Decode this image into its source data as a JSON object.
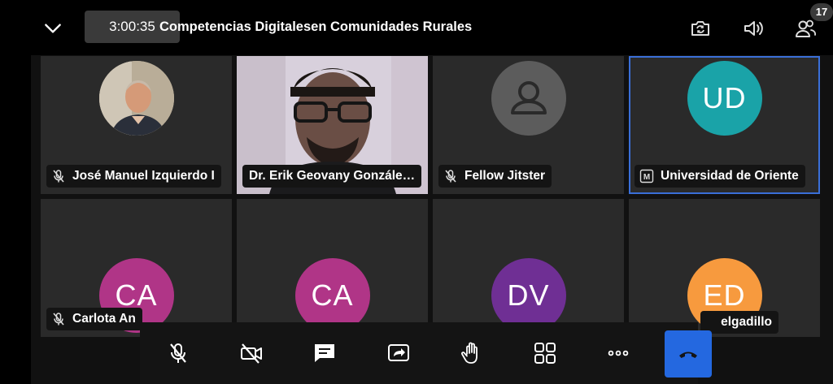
{
  "header": {
    "timer": "3:00:35",
    "title": "Competencias Digitalesen Comunidades Rurales",
    "participant_count": "17"
  },
  "participants": [
    {
      "name": "José Manuel Izquierdo I",
      "initials": "",
      "avatar_color": "#c9a07a",
      "muted": true,
      "type": "photo"
    },
    {
      "name": "Dr. Erik Geovany Gonzále…",
      "initials": "",
      "muted": false,
      "type": "video"
    },
    {
      "name": "Fellow Jitster",
      "initials": "",
      "avatar_color": "#5a5a5a",
      "muted": true,
      "type": "placeholder"
    },
    {
      "name": "Universidad de Oriente",
      "initials": "UD",
      "avatar_color": "#1aa3a8",
      "muted": false,
      "type": "initials",
      "moderator_icon": "M"
    },
    {
      "name": "Carlota An",
      "initials": "CA",
      "avatar_color": "#b03587",
      "muted": true,
      "type": "initials"
    },
    {
      "name": "",
      "initials": "CA",
      "avatar_color": "#b03587",
      "muted": false,
      "type": "initials"
    },
    {
      "name": "",
      "initials": "DV",
      "avatar_color": "#6f2f94",
      "muted": false,
      "type": "initials"
    },
    {
      "name": "elgadillo",
      "initials": "ED",
      "avatar_color": "#f79a3e",
      "muted": false,
      "type": "initials"
    }
  ],
  "toolbar": {
    "items": [
      "microphone-muted-icon",
      "camera-off-icon",
      "chat-icon",
      "share-screen-icon",
      "raise-hand-icon",
      "tile-view-icon",
      "more-options-icon"
    ],
    "hangup_color": "#2468e0"
  }
}
